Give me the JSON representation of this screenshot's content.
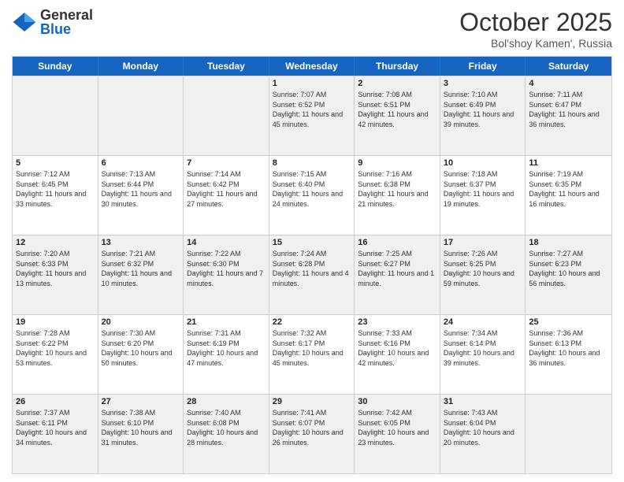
{
  "header": {
    "logo": {
      "general": "General",
      "blue": "Blue"
    },
    "month": "October 2025",
    "location": "Bol'shoy Kamen', Russia"
  },
  "weekdays": [
    "Sunday",
    "Monday",
    "Tuesday",
    "Wednesday",
    "Thursday",
    "Friday",
    "Saturday"
  ],
  "rows": [
    [
      {
        "day": "",
        "info": "",
        "empty": true
      },
      {
        "day": "",
        "info": "",
        "empty": true
      },
      {
        "day": "",
        "info": "",
        "empty": true
      },
      {
        "day": "1",
        "info": "Sunrise: 7:07 AM\nSunset: 6:52 PM\nDaylight: 11 hours and 45 minutes."
      },
      {
        "day": "2",
        "info": "Sunrise: 7:08 AM\nSunset: 6:51 PM\nDaylight: 11 hours and 42 minutes."
      },
      {
        "day": "3",
        "info": "Sunrise: 7:10 AM\nSunset: 6:49 PM\nDaylight: 11 hours and 39 minutes."
      },
      {
        "day": "4",
        "info": "Sunrise: 7:11 AM\nSunset: 6:47 PM\nDaylight: 11 hours and 36 minutes."
      }
    ],
    [
      {
        "day": "5",
        "info": "Sunrise: 7:12 AM\nSunset: 6:45 PM\nDaylight: 11 hours and 33 minutes."
      },
      {
        "day": "6",
        "info": "Sunrise: 7:13 AM\nSunset: 6:44 PM\nDaylight: 11 hours and 30 minutes."
      },
      {
        "day": "7",
        "info": "Sunrise: 7:14 AM\nSunset: 6:42 PM\nDaylight: 11 hours and 27 minutes."
      },
      {
        "day": "8",
        "info": "Sunrise: 7:15 AM\nSunset: 6:40 PM\nDaylight: 11 hours and 24 minutes."
      },
      {
        "day": "9",
        "info": "Sunrise: 7:16 AM\nSunset: 6:38 PM\nDaylight: 11 hours and 21 minutes."
      },
      {
        "day": "10",
        "info": "Sunrise: 7:18 AM\nSunset: 6:37 PM\nDaylight: 11 hours and 19 minutes."
      },
      {
        "day": "11",
        "info": "Sunrise: 7:19 AM\nSunset: 6:35 PM\nDaylight: 11 hours and 16 minutes."
      }
    ],
    [
      {
        "day": "12",
        "info": "Sunrise: 7:20 AM\nSunset: 6:33 PM\nDaylight: 11 hours and 13 minutes."
      },
      {
        "day": "13",
        "info": "Sunrise: 7:21 AM\nSunset: 6:32 PM\nDaylight: 11 hours and 10 minutes."
      },
      {
        "day": "14",
        "info": "Sunrise: 7:22 AM\nSunset: 6:30 PM\nDaylight: 11 hours and 7 minutes."
      },
      {
        "day": "15",
        "info": "Sunrise: 7:24 AM\nSunset: 6:28 PM\nDaylight: 11 hours and 4 minutes."
      },
      {
        "day": "16",
        "info": "Sunrise: 7:25 AM\nSunset: 6:27 PM\nDaylight: 11 hours and 1 minute."
      },
      {
        "day": "17",
        "info": "Sunrise: 7:26 AM\nSunset: 6:25 PM\nDaylight: 10 hours and 59 minutes."
      },
      {
        "day": "18",
        "info": "Sunrise: 7:27 AM\nSunset: 6:23 PM\nDaylight: 10 hours and 56 minutes."
      }
    ],
    [
      {
        "day": "19",
        "info": "Sunrise: 7:28 AM\nSunset: 6:22 PM\nDaylight: 10 hours and 53 minutes."
      },
      {
        "day": "20",
        "info": "Sunrise: 7:30 AM\nSunset: 6:20 PM\nDaylight: 10 hours and 50 minutes."
      },
      {
        "day": "21",
        "info": "Sunrise: 7:31 AM\nSunset: 6:19 PM\nDaylight: 10 hours and 47 minutes."
      },
      {
        "day": "22",
        "info": "Sunrise: 7:32 AM\nSunset: 6:17 PM\nDaylight: 10 hours and 45 minutes."
      },
      {
        "day": "23",
        "info": "Sunrise: 7:33 AM\nSunset: 6:16 PM\nDaylight: 10 hours and 42 minutes."
      },
      {
        "day": "24",
        "info": "Sunrise: 7:34 AM\nSunset: 6:14 PM\nDaylight: 10 hours and 39 minutes."
      },
      {
        "day": "25",
        "info": "Sunrise: 7:36 AM\nSunset: 6:13 PM\nDaylight: 10 hours and 36 minutes."
      }
    ],
    [
      {
        "day": "26",
        "info": "Sunrise: 7:37 AM\nSunset: 6:11 PM\nDaylight: 10 hours and 34 minutes."
      },
      {
        "day": "27",
        "info": "Sunrise: 7:38 AM\nSunset: 6:10 PM\nDaylight: 10 hours and 31 minutes."
      },
      {
        "day": "28",
        "info": "Sunrise: 7:40 AM\nSunset: 6:08 PM\nDaylight: 10 hours and 28 minutes."
      },
      {
        "day": "29",
        "info": "Sunrise: 7:41 AM\nSunset: 6:07 PM\nDaylight: 10 hours and 26 minutes."
      },
      {
        "day": "30",
        "info": "Sunrise: 7:42 AM\nSunset: 6:05 PM\nDaylight: 10 hours and 23 minutes."
      },
      {
        "day": "31",
        "info": "Sunrise: 7:43 AM\nSunset: 6:04 PM\nDaylight: 10 hours and 20 minutes."
      },
      {
        "day": "",
        "info": "",
        "empty": true
      }
    ]
  ]
}
